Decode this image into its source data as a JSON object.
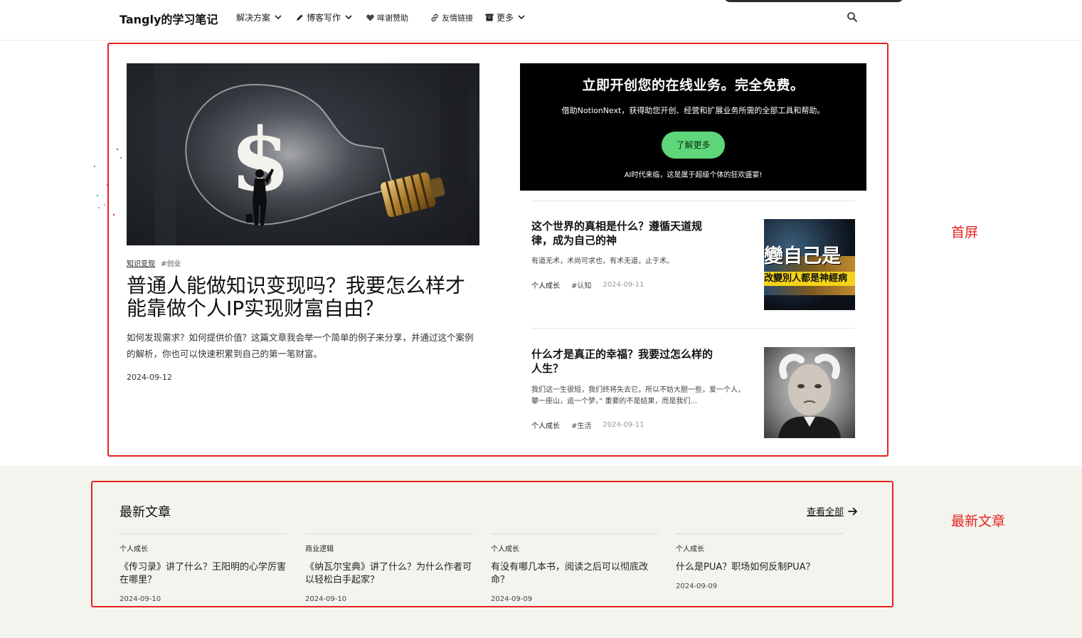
{
  "header": {
    "logo": "Tangly的学习笔记",
    "nav": [
      {
        "label": "解决方案",
        "icon": null,
        "has_dropdown": true
      },
      {
        "label": "博客写作",
        "icon": "pen-icon",
        "has_dropdown": true
      },
      {
        "label": "哞谢赞助",
        "icon": "heart-icon",
        "has_dropdown": false
      },
      {
        "label": "友情链接",
        "icon": "link-icon",
        "has_dropdown": false
      },
      {
        "label": "更多",
        "icon": "archive-icon",
        "has_dropdown": true
      }
    ],
    "search_icon": "search-icon"
  },
  "hero": {
    "category": "知识变现",
    "tag": "#创业",
    "title": "普通人能做知识变现吗？我要怎么样才能靠做个人IP实现财富自由？",
    "excerpt": "如何发现需求？如何提供价值？这篇文章我会举一个简单的例子来分享，并通过这个案例的解析，你也可以快速积累到自己的第一笔财富。",
    "date": "2024-09-12",
    "image": "lightbulb-dollar-illustration"
  },
  "promo": {
    "title": "立即开创您的在线业务。完全免费。",
    "subtitle": "借助NotionNext，获得助您开创、经营和扩展业务所需的全部工具和帮助。",
    "button": "了解更多",
    "footer": "AI时代来临，这是属于超级个体的狂欢盛宴!",
    "button_color": "#5fd67a"
  },
  "side_posts": [
    {
      "title": "这个世界的真相是什么？遵循天道规律，成为自己的神",
      "excerpt": "有道无术，术尚可求也，有术无道，止于术。",
      "category": "个人成长",
      "tag": "#认知",
      "date": "2024-09-11",
      "thumb_text_1": "變自己是",
      "thumb_text_2": "改變別人都是神經病"
    },
    {
      "title": "什么才是真正的幸福？我要过怎么样的人生？",
      "excerpt": "我们这一生很短，我们终将失去它，所以不妨大胆一些，爱一个人，攀一座山，追一个梦。” 重要的不是结果，而是我们...",
      "category": "个人成长",
      "tag": "#生活",
      "date": "2024-09-11",
      "thumb_text_1": "",
      "thumb_text_2": ""
    }
  ],
  "annotations": {
    "first_screen": "首屏",
    "latest": "最新文章",
    "color": "#e5231f"
  },
  "latest": {
    "title": "最新文章",
    "view_all": "查看全部",
    "posts": [
      {
        "category": "个人成长",
        "title": "《传习录》讲了什么？王阳明的心学厉害在哪里？",
        "date": "2024-09-10"
      },
      {
        "category": "商业逻辑",
        "title": "《纳瓦尔宝典》讲了什么？为什么作者可以轻松白手起家？",
        "date": "2024-09-10"
      },
      {
        "category": "个人成长",
        "title": "有没有哪几本书，阅读之后可以彻底改命？",
        "date": "2024-09-09"
      },
      {
        "category": "个人成长",
        "title": "什么是PUA？职场如何反制PUA？",
        "date": "2024-09-09"
      }
    ]
  }
}
